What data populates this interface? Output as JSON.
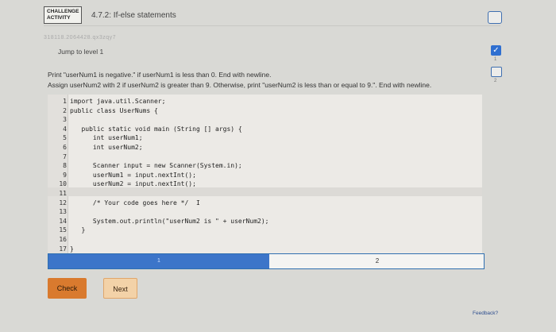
{
  "header": {
    "badge_line1": "CHALLENGE",
    "badge_line2": "ACTIVITY",
    "title": "4.7.2: If-else statements"
  },
  "sub_id": "318118.2064428.qx3zqy7",
  "jump_label": "Jump to level 1",
  "levels": [
    "1",
    "2"
  ],
  "instructions": {
    "line1": "Print \"userNum1 is negative.\" if userNum1 is less than 0. End with newline.",
    "line2": "Assign userNum2 with 2 if userNum2 is greater than 9. Otherwise, print \"userNum2 is less than or equal to 9.\". End with newline."
  },
  "code_lines": [
    {
      "n": "1",
      "t": "import java.util.Scanner;"
    },
    {
      "n": "2",
      "t": "public class UserNums {"
    },
    {
      "n": "3",
      "t": ""
    },
    {
      "n": "4",
      "t": "   public static void main (String [] args) {"
    },
    {
      "n": "5",
      "t": "      int userNum1;"
    },
    {
      "n": "6",
      "t": "      int userNum2;"
    },
    {
      "n": "7",
      "t": ""
    },
    {
      "n": "8",
      "t": "      Scanner input = new Scanner(System.in);"
    },
    {
      "n": "9",
      "t": "      userNum1 = input.nextInt();"
    },
    {
      "n": "10",
      "t": "      userNum2 = input.nextInt();"
    },
    {
      "n": "11",
      "t": ""
    },
    {
      "n": "12",
      "t": "      /* Your code goes here */  I"
    },
    {
      "n": "13",
      "t": ""
    },
    {
      "n": "14",
      "t": "      System.out.println(\"userNum2 is \" + userNum2);"
    },
    {
      "n": "15",
      "t": "   }"
    },
    {
      "n": "16",
      "t": ""
    },
    {
      "n": "17",
      "t": "}"
    }
  ],
  "progress": {
    "seg1": "1",
    "seg2": "2"
  },
  "buttons": {
    "check": "Check",
    "next": "Next"
  },
  "feedback": "Feedback?",
  "colors": {
    "accent": "#3c75c9",
    "check": "#d97a2e",
    "next": "#f3d2a8"
  }
}
